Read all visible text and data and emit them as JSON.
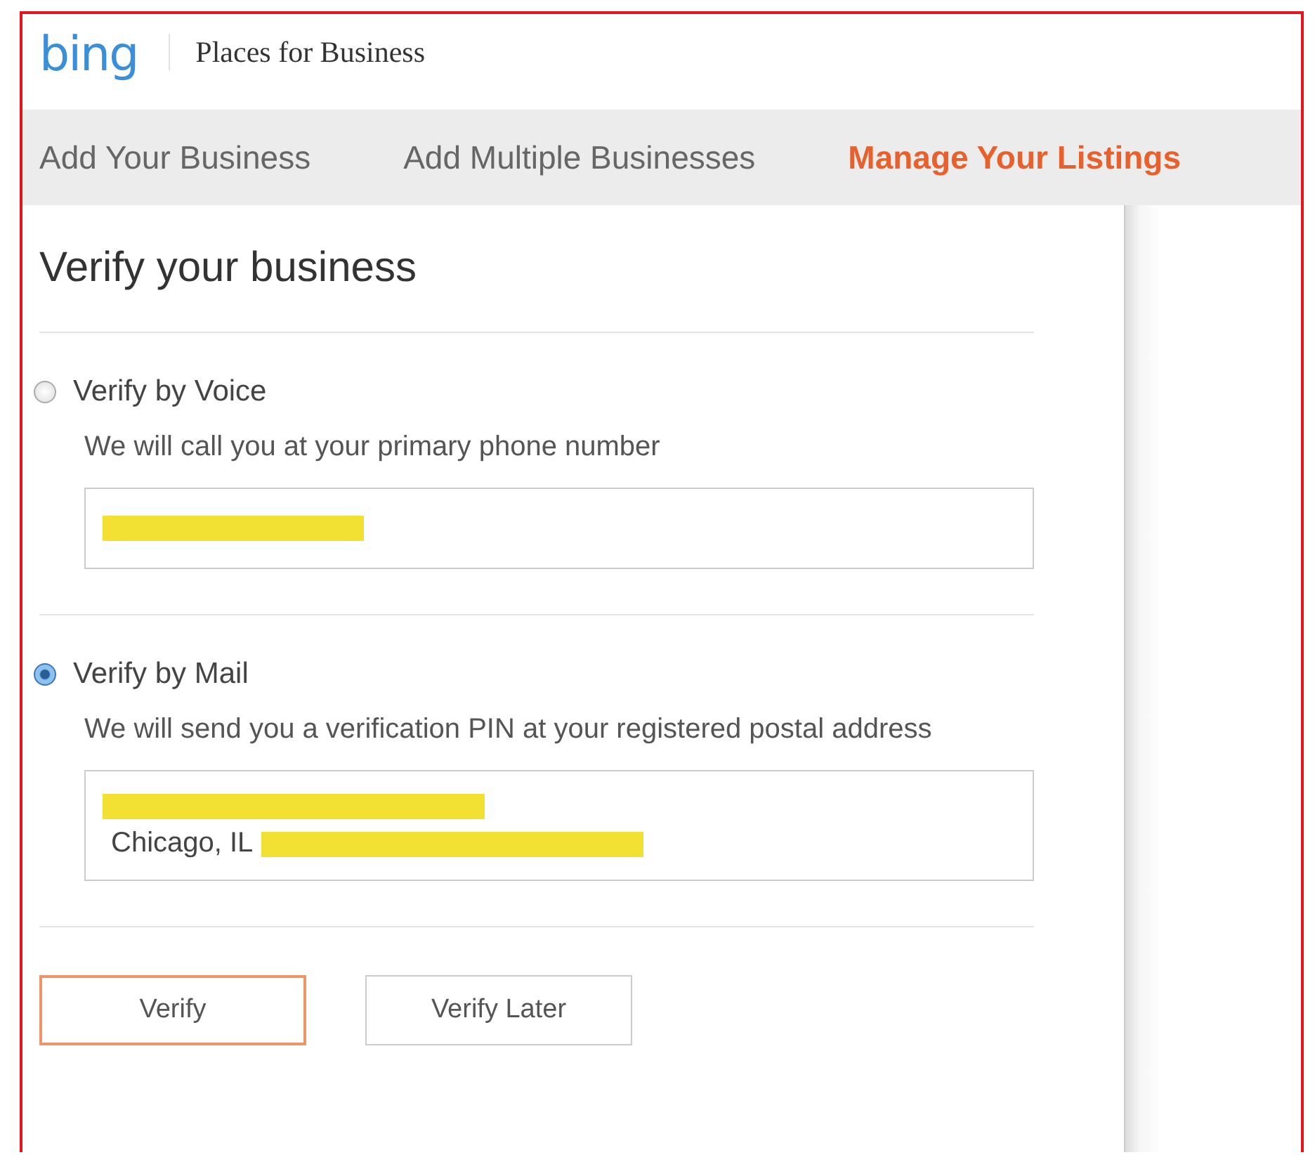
{
  "header": {
    "logo": "bing",
    "title": "Places for Business"
  },
  "tabs": [
    {
      "label": "Add Your Business",
      "selected": false
    },
    {
      "label": "Add Multiple Businesses",
      "selected": false
    },
    {
      "label": "Manage Your Listings",
      "selected": true
    }
  ],
  "heading": "Verify your business",
  "options": [
    {
      "label": "Verify by Voice",
      "selected": false,
      "description": "We will call you at your primary phone number",
      "field_lines": [
        {
          "redacted": true
        }
      ]
    },
    {
      "label": "Verify by Mail",
      "selected": true,
      "description": "We will send you a verification PIN at your registered postal address",
      "field_lines": [
        {
          "redacted": true
        },
        {
          "text": "Chicago, IL",
          "redacted": true
        }
      ]
    }
  ],
  "buttons": [
    {
      "label": "Verify",
      "kind": "primary"
    },
    {
      "label": "Verify Later",
      "kind": "secondary"
    }
  ]
}
